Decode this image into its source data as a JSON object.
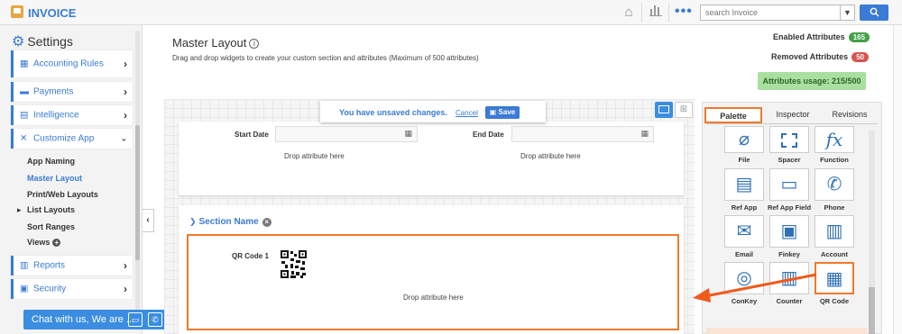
{
  "app": {
    "title": "INVOICE"
  },
  "search": {
    "placeholder": "search Invoice",
    "button_icon": "search-icon"
  },
  "sidebar": {
    "heading": "Settings",
    "items": [
      {
        "label": "Accounting Rules",
        "icon": "calculator-icon"
      },
      {
        "label": "Payments",
        "icon": "card-icon"
      },
      {
        "label": "Intelligence",
        "icon": "chart-icon"
      },
      {
        "label": "Customize App",
        "icon": "tools-icon"
      },
      {
        "label": "Reports",
        "icon": "report-icon"
      },
      {
        "label": "Security",
        "icon": "lock-icon"
      }
    ],
    "subitems": [
      "App Naming",
      "Master Layout",
      "Print/Web Layouts",
      "List Layouts",
      "Sort Ranges",
      "Views"
    ]
  },
  "chat": {
    "label": "Chat with us, We are ..."
  },
  "main": {
    "title": "Master Layout",
    "subtitle": "Drag and drop widgets to create your custom section and attributes (Maximum of 500 attributes)",
    "enabled_label": "Enabled Attributes",
    "enabled_count": "165",
    "removed_label": "Removed Attributes",
    "removed_count": "50",
    "usage": "Attributes usage: 215/500"
  },
  "toast": {
    "message": "You have unsaved changes.",
    "cancel": "Cancel",
    "save": "Save"
  },
  "section1": {
    "start_date": "Start Date",
    "end_date": "End Date",
    "drop_hint": "Drop attribute here"
  },
  "section2": {
    "name": "Section Name",
    "qr_label": "QR Code 1",
    "drop_hint": "Drop attribute here"
  },
  "panel": {
    "tabs": [
      "Palette",
      "Inspector",
      "Revisions"
    ],
    "tiles": [
      {
        "label": "File",
        "icon": "paperclip-icon"
      },
      {
        "label": "Spacer",
        "icon": "spacer-icon"
      },
      {
        "label": "Function",
        "icon": "function-icon"
      },
      {
        "label": "Ref App",
        "icon": "ref-app-icon"
      },
      {
        "label": "Ref App Field",
        "icon": "ref-field-icon"
      },
      {
        "label": "Phone",
        "icon": "phone-icon"
      },
      {
        "label": "Email",
        "icon": "email-icon"
      },
      {
        "label": "Finkey",
        "icon": "finkey-icon"
      },
      {
        "label": "Account",
        "icon": "account-icon"
      },
      {
        "label": "ConKey",
        "icon": "conkey-icon"
      },
      {
        "label": "Counter",
        "icon": "counter-icon"
      },
      {
        "label": "QR Code",
        "icon": "qr-code-icon"
      }
    ]
  },
  "colors": {
    "accent": "#3a7bd5",
    "highlight": "#ef7a2c",
    "enabled": "#43a047",
    "removed": "#d9534f",
    "usage_bg": "#a9dfa0"
  }
}
